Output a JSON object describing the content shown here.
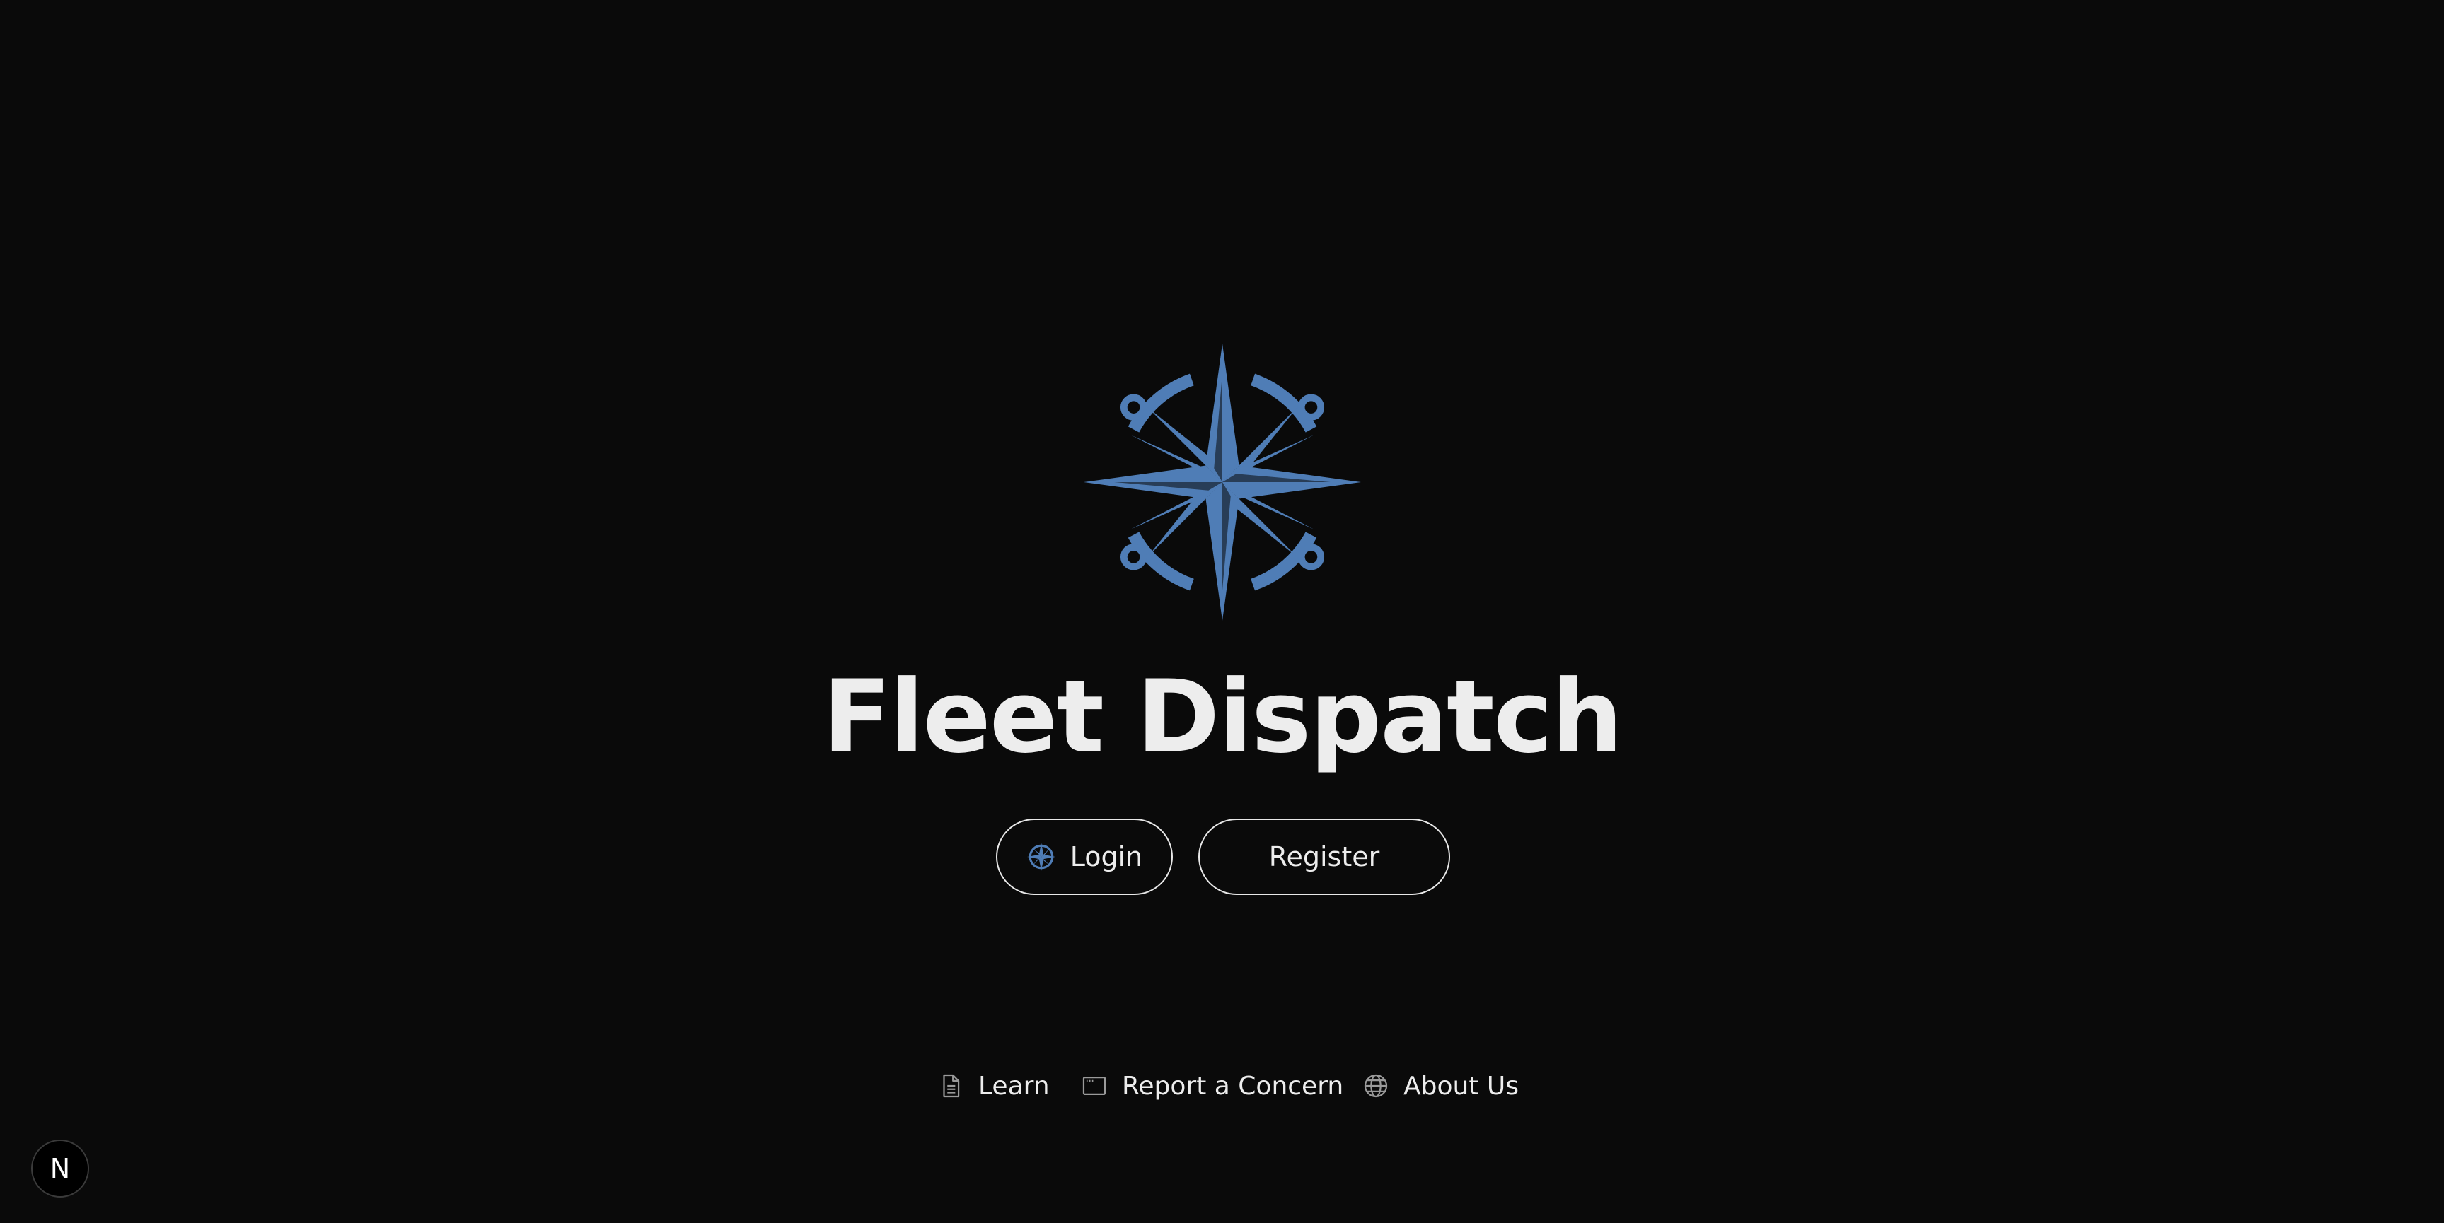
{
  "app": {
    "title": "Fleet Dispatch",
    "logo_icon": "compass-rose-icon",
    "accent_color": "#4f7db6",
    "background_color": "#0a0a0a",
    "text_color": "#ededed"
  },
  "actions": {
    "login_label": "Login",
    "login_icon": "compass-rose-icon",
    "register_label": "Register"
  },
  "footer": {
    "links": [
      {
        "label": "Learn",
        "icon": "file-icon"
      },
      {
        "label": "Report a Concern",
        "icon": "window-icon"
      },
      {
        "label": "About Us",
        "icon": "globe-icon"
      }
    ]
  },
  "dev_indicator": {
    "label": "N",
    "icon": "nextjs-logo-icon"
  }
}
